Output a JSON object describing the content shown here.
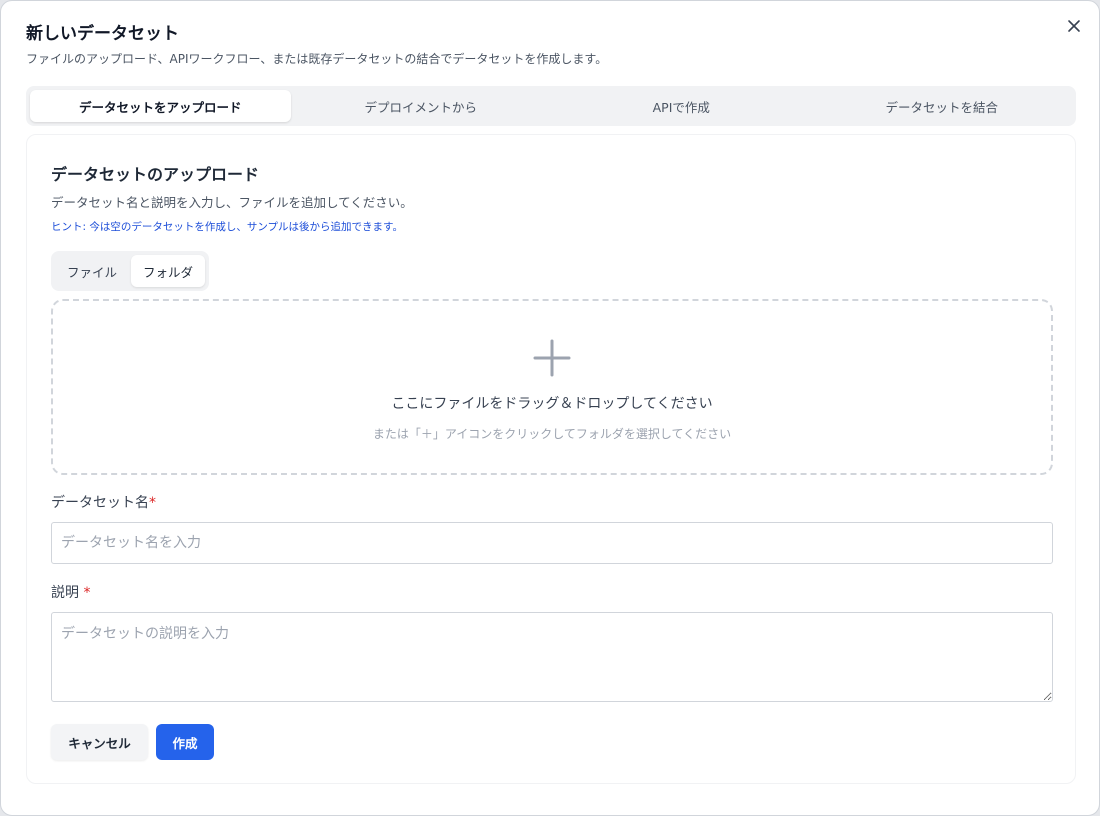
{
  "dialog": {
    "title": "新しいデータセット",
    "subtitle": "ファイルのアップロード、APIワークフロー、または既存データセットの結合でデータセットを作成します。",
    "close_icon": "close-icon"
  },
  "tabs": [
    {
      "label": "データセットをアップロード",
      "active": true
    },
    {
      "label": "デプロイメントから",
      "active": false
    },
    {
      "label": "APIで作成",
      "active": false
    },
    {
      "label": "データセットを結合",
      "active": false
    }
  ],
  "upload": {
    "title": "データセットのアップロード",
    "description": "データセット名と説明を入力し、ファイルを追加してください。",
    "hint": "ヒント: 今は空のデータセットを作成し、サンプルは後から追加できます。",
    "mode_options": [
      {
        "label": "ファイル",
        "active": false
      },
      {
        "label": "フォルダ",
        "active": true
      }
    ],
    "dropzone": {
      "icon": "plus-icon",
      "main_text": "ここにファイルをドラッグ＆ドロップしてください",
      "sub_text": "または「＋」アイコンをクリックしてフォルダを選択してください"
    }
  },
  "form": {
    "name_label": "データセット名",
    "name_required_mark": "*",
    "name_value": "",
    "name_placeholder": "データセット名を入力",
    "description_label": "説明",
    "description_required_mark": "*",
    "description_value": "",
    "description_placeholder": "データセットの説明を入力"
  },
  "actions": {
    "cancel_label": "キャンセル",
    "create_label": "作成"
  },
  "colors": {
    "primary": "#2563eb",
    "required": "#dc2626",
    "hint": "#1d4ed8"
  }
}
